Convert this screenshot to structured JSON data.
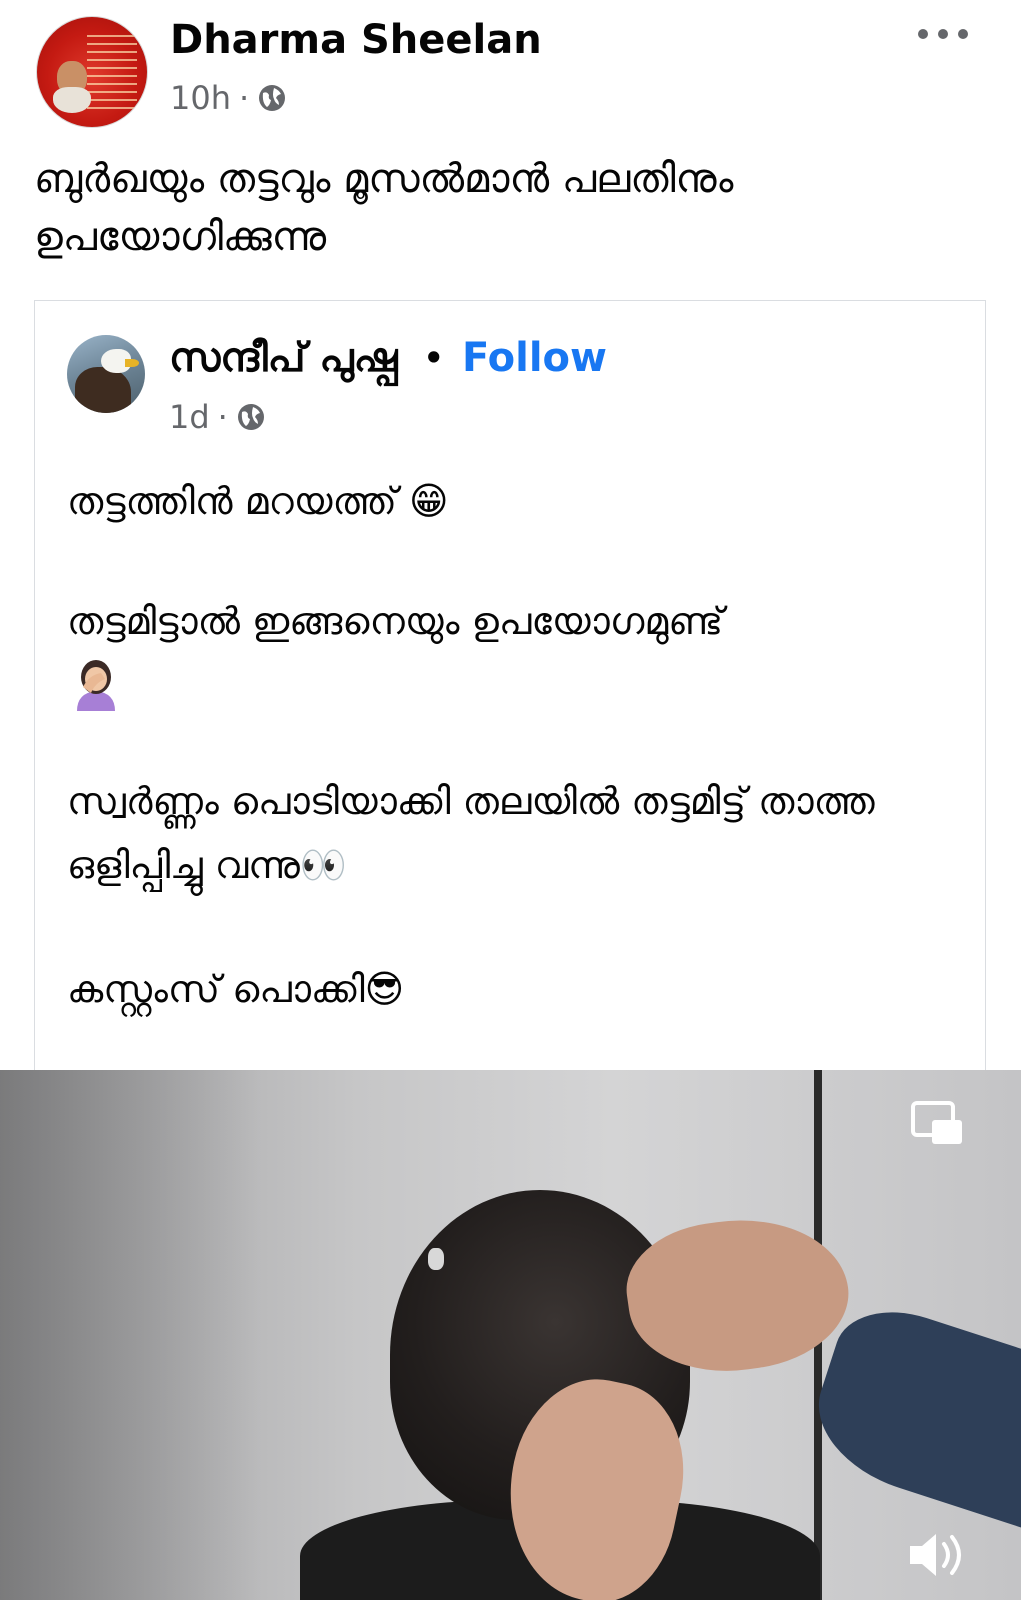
{
  "post": {
    "author": "Dharma Sheelan",
    "time": "10h",
    "separator": "·",
    "privacy_icon": "globe-icon",
    "more_icon": "more-options-icon",
    "text": "ബുർഖയും തട്ടവും മൂസൽമാൻ പലതിനും ഉപയോഗിക്കുന്നു"
  },
  "shared_post": {
    "author": "സന്ദീപ് പുഷ്പ",
    "separator": "•",
    "follow_label": "Follow",
    "time": "1d",
    "meta_separator": "·",
    "privacy_icon": "globe-icon",
    "lines": [
      "തട്ടത്തിൻ മറയത്ത് 😁",
      "തട്ടമിട്ടാൽ ഇങ്ങനെയും  ഉപയോഗമുണ്ട്",
      " സ്വർണ്ണം പൊടിയാക്കി തലയിൽ തട്ടമിട്ട് താത്ത ഒളിപ്പിച്ചു വന്നു👀",
      " കസ്റ്റംസ് പൊക്കി😎"
    ],
    "emoji_facepalm": "woman-facepalming-emoji"
  },
  "video": {
    "pip_icon": "picture-in-picture-icon",
    "volume_icon": "volume-icon"
  },
  "colors": {
    "link_blue": "#1877f2",
    "secondary_text": "#65676b",
    "primary_text": "#050505",
    "card_border": "#dadde1"
  }
}
